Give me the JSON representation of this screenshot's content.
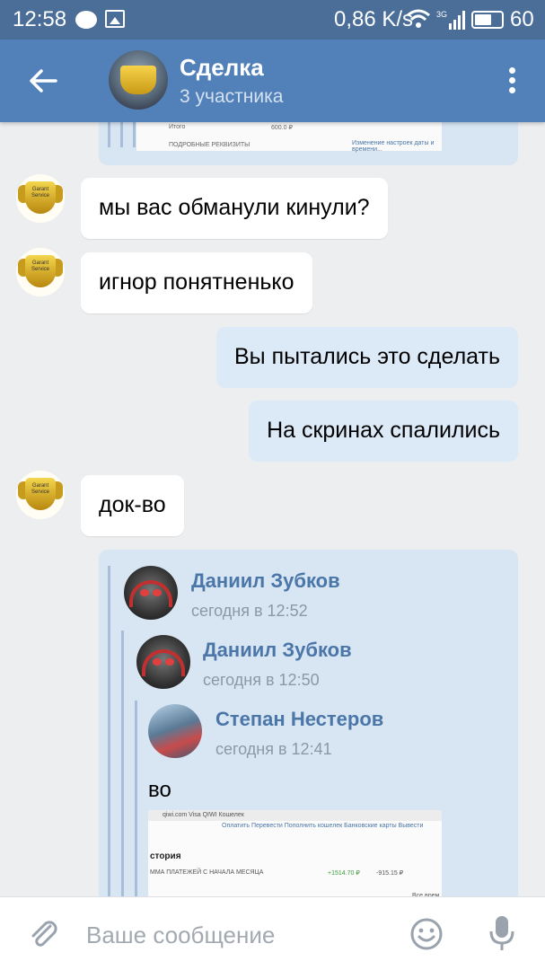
{
  "status_bar": {
    "time": "12:58",
    "network_speed": "0,86 K/s",
    "signal_label": "3G",
    "battery_percent": "60"
  },
  "toolbar": {
    "title": "Сделка",
    "subtitle": "3 участника",
    "avatar_icon": "garant-service-logo"
  },
  "top_forward_preview": {
    "left_text": "Итого",
    "amount": "600.0 ₽",
    "details": "ПОДРОБНЫЕ РЕКВИЗИТЫ",
    "link": "Изменение настроек даты и времени..."
  },
  "messages": [
    {
      "direction": "incoming",
      "text": "мы вас обманули кинули?"
    },
    {
      "direction": "incoming",
      "text": "игнор понятненько"
    },
    {
      "direction": "outgoing",
      "text": "Вы пытались это сделать"
    },
    {
      "direction": "outgoing",
      "text": "На скринах спалились"
    },
    {
      "direction": "incoming",
      "text": "док-во"
    }
  ],
  "forwarded": [
    {
      "name": "Даниил Зубков",
      "time": "сегодня в 12:52"
    },
    {
      "name": "Даниил Зубков",
      "time": "сегодня в 12:50"
    },
    {
      "name": "Степан Нестеров",
      "time": "сегодня в 12:41"
    }
  ],
  "forwarded_text": "во",
  "screenshot_preview": {
    "url": "qiwi.com   Visa QIWI Кошелек",
    "menu": "Оплатить   Перевести   Пополнить кошелек   Банковские карты   Вывести",
    "heading": "стория",
    "subheading": "ММА ПЛАТЕЖЕЙ С НАЧАЛА МЕСЯЦА",
    "income": "+1514.70 ₽",
    "outcome": "-915.15 ₽",
    "side_label": "Все врем"
  },
  "composer": {
    "placeholder": "Ваше сообщение"
  },
  "colors": {
    "status_bar": "#4a6e98",
    "toolbar": "#5181b8",
    "background": "#edeef0",
    "incoming_bubble": "#ffffff",
    "outgoing_bubble": "#dce9f7",
    "forward_block": "#d8e5f3",
    "link_name": "#4a76a8"
  }
}
